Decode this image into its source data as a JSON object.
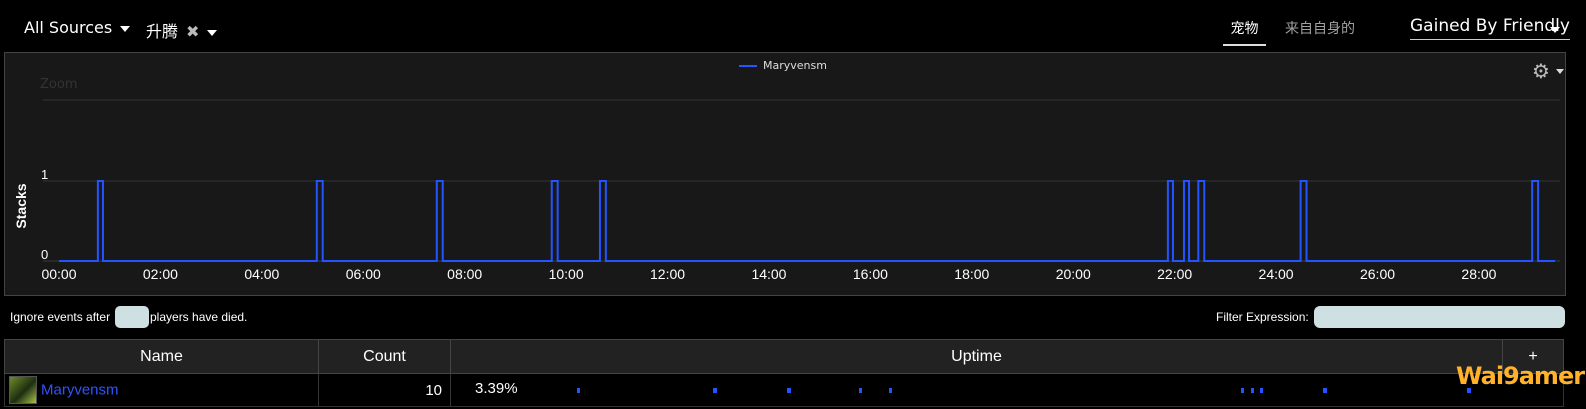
{
  "toolbar": {
    "sources_label": "All Sources",
    "ability_label": "升腾",
    "tab_pets": "宠物",
    "tab_self": "来自自身的",
    "gain_mode": "Gained By Friendly"
  },
  "icons": {
    "gear": "gear-icon",
    "close": "close-icon",
    "chevron": "chevron-down-icon"
  },
  "chart_data": {
    "type": "line",
    "xlabel": "",
    "ylabel": "Stacks",
    "zoom_label": "Zoom",
    "ylim": [
      0,
      1
    ],
    "xlim_seconds": [
      0,
      1770
    ],
    "x_tick_labels": [
      "00:00",
      "02:00",
      "04:00",
      "06:00",
      "08:00",
      "10:00",
      "12:00",
      "14:00",
      "16:00",
      "18:00",
      "20:00",
      "22:00",
      "24:00",
      "26:00",
      "28:00"
    ],
    "y_tick_labels": [
      "0",
      "1"
    ],
    "series": [
      {
        "name": "Maryvensm",
        "color": "#2255ff",
        "on_intervals_seconds": [
          [
            46,
            52
          ],
          [
            305,
            312
          ],
          [
            447,
            454
          ],
          [
            583,
            590
          ],
          [
            640,
            647
          ],
          [
            1312,
            1318
          ],
          [
            1331,
            1337
          ],
          [
            1348,
            1355
          ],
          [
            1469,
            1476
          ],
          [
            1743,
            1750
          ]
        ]
      }
    ]
  },
  "filters": {
    "ignore_prefix": "Ignore events after",
    "ignore_suffix": "players have died.",
    "filter_label": "Filter Expression:"
  },
  "table": {
    "headers": {
      "name": "Name",
      "count": "Count",
      "uptime": "Uptime",
      "add": "+"
    },
    "rows": [
      {
        "name": "Maryvensm",
        "count": "10",
        "uptime": "3.39%"
      }
    ]
  },
  "watermark": "Wai9amer"
}
